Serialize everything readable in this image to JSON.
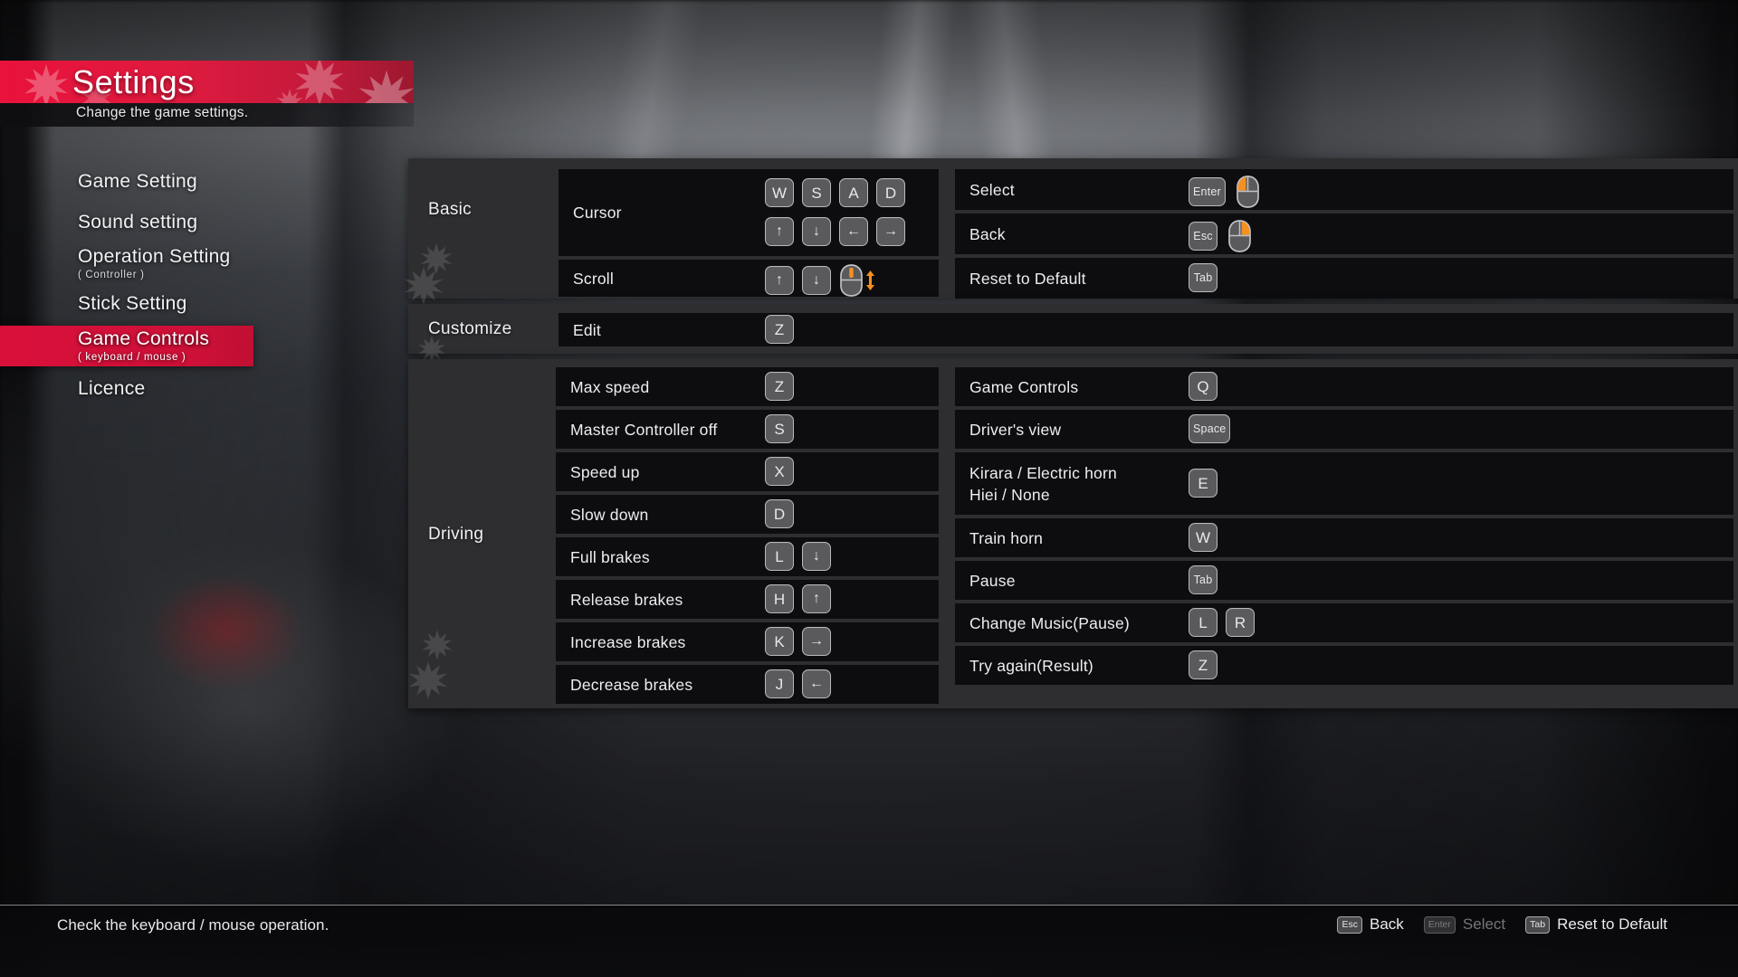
{
  "header": {
    "title": "Settings",
    "subtitle": "Change the game settings."
  },
  "sidebar": {
    "items": [
      {
        "label": "Game Setting",
        "sub": "",
        "selected": false
      },
      {
        "label": "Sound setting",
        "sub": "",
        "selected": false
      },
      {
        "label": "Operation Setting",
        "sub": "( Controller )",
        "selected": false
      },
      {
        "label": "Stick Setting",
        "sub": "",
        "selected": false
      },
      {
        "label": "Game Controls",
        "sub": "( keyboard / mouse )",
        "selected": true
      },
      {
        "label": "Licence",
        "sub": "",
        "selected": false
      }
    ],
    "selected_color": "#d9103a"
  },
  "panels": {
    "basic": {
      "category": "Basic",
      "left_rows": [
        {
          "label": "Cursor",
          "keys_row1": [
            "W",
            "S",
            "A",
            "D"
          ],
          "keys_row2": [
            "↑",
            "↓",
            "←",
            "→"
          ]
        },
        {
          "label": "Scroll",
          "keys": [
            "↑",
            "↓"
          ],
          "mouse": "scroll-wheel"
        }
      ],
      "right_rows": [
        {
          "label": "Select",
          "keys": [
            "Enter"
          ],
          "mouse": "left-button"
        },
        {
          "label": "Back",
          "keys": [
            "Esc"
          ],
          "mouse": "right-button"
        },
        {
          "label": "Reset to Default",
          "keys": [
            "Tab"
          ],
          "mouse": ""
        }
      ]
    },
    "customize": {
      "category": "Customize",
      "rows": [
        {
          "label": "Edit",
          "keys": [
            "Z"
          ]
        }
      ]
    },
    "driving": {
      "category": "Driving",
      "left_rows": [
        {
          "label": "Max speed",
          "keys": [
            "Z"
          ]
        },
        {
          "label": "Master Controller off",
          "keys": [
            "S"
          ]
        },
        {
          "label": "Speed up",
          "keys": [
            "X"
          ]
        },
        {
          "label": "Slow down",
          "keys": [
            "D"
          ]
        },
        {
          "label": "Full brakes",
          "keys": [
            "L",
            "↓"
          ]
        },
        {
          "label": "Release brakes",
          "keys": [
            "H",
            "↑"
          ]
        },
        {
          "label": "Increase brakes",
          "keys": [
            "K",
            "→"
          ]
        },
        {
          "label": "Decrease brakes",
          "keys": [
            "J",
            "←"
          ]
        }
      ],
      "right_rows": [
        {
          "label": "Game Controls",
          "keys": [
            "Q"
          ]
        },
        {
          "label": "Driver's view",
          "keys": [
            "Space"
          ]
        },
        {
          "label": "Kirara / Electric horn\nHiei / None",
          "keys": [
            "E"
          ]
        },
        {
          "label": "Train horn",
          "keys": [
            "W"
          ]
        },
        {
          "label": "Pause",
          "keys": [
            "Tab"
          ]
        },
        {
          "label": "Change Music(Pause)",
          "keys": [
            "L",
            "R"
          ]
        },
        {
          "label": "Try again(Result)",
          "keys": [
            "Z"
          ]
        }
      ]
    }
  },
  "footer": {
    "hint": "Check the keyboard / mouse operation.",
    "actions": [
      {
        "key": "Esc",
        "label": "Back",
        "dimmed": false
      },
      {
        "key": "Enter",
        "label": "Select",
        "dimmed": true
      },
      {
        "key": "Tab",
        "label": "Reset to Default",
        "dimmed": false
      }
    ]
  },
  "colors": {
    "accent_red": "#d9103a",
    "panel_bg": "#2e2e30",
    "row_bg": "#0d0d0f",
    "highlight_orange": "#f5901e"
  }
}
